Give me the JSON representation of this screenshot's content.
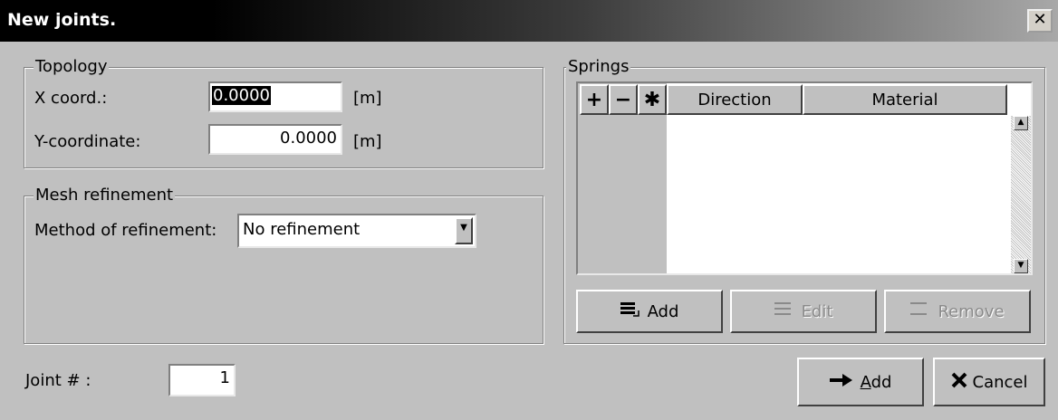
{
  "window": {
    "title": "New joints.",
    "close_glyph": "✕"
  },
  "topology": {
    "legend": "Topology",
    "x_label": "X coord.:",
    "x_value": "0.0000",
    "x_unit": "[m]",
    "y_label": "Y-coordinate:",
    "y_value": "0.0000",
    "y_unit": "[m]"
  },
  "mesh": {
    "legend": "Mesh refinement",
    "method_label": "Method of refinement:",
    "method_value": "No refinement"
  },
  "springs": {
    "legend": "Springs",
    "toolbar": {
      "plus": "+",
      "minus": "−",
      "star": "✱"
    },
    "columns": [
      "Direction",
      "Material"
    ],
    "add_label": "Add",
    "edit_label": "Edit",
    "remove_label": "Remove",
    "add_icon": "list-add-icon",
    "edit_icon": "list-edit-icon",
    "remove_icon": "list-remove-icon"
  },
  "joint": {
    "label": "Joint # :",
    "value": "1"
  },
  "footer": {
    "add_label": "Add",
    "add_mnemonic": "A",
    "add_rest": "dd",
    "cancel_label": "Cancel",
    "add_icon": "arrow-right-icon",
    "cancel_icon": "x-cancel-icon"
  }
}
